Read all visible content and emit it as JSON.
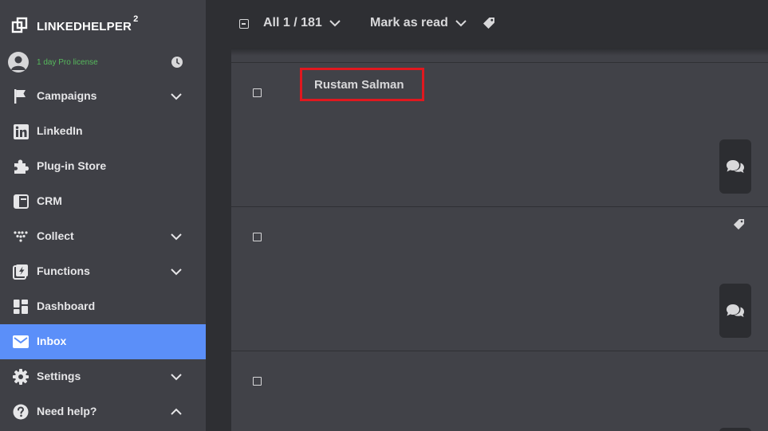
{
  "brand": {
    "name": "LINKEDHELPER",
    "superscript": "2"
  },
  "license": {
    "text": "1 day Pro license"
  },
  "nav": [
    {
      "id": "campaigns",
      "label": "Campaigns",
      "icon": "flag-icon",
      "expandable": true,
      "expanded": false
    },
    {
      "id": "linkedin",
      "label": "LinkedIn",
      "icon": "linkedin-icon",
      "expandable": false
    },
    {
      "id": "plugin-store",
      "label": "Plug-in Store",
      "icon": "puzzle-icon",
      "expandable": false
    },
    {
      "id": "crm",
      "label": "CRM",
      "icon": "crm-icon",
      "expandable": false
    },
    {
      "id": "collect",
      "label": "Collect",
      "icon": "collect-icon",
      "expandable": true,
      "expanded": false
    },
    {
      "id": "functions",
      "label": "Functions",
      "icon": "functions-icon",
      "expandable": true,
      "expanded": false
    },
    {
      "id": "dashboard",
      "label": "Dashboard",
      "icon": "dashboard-icon",
      "expandable": false
    },
    {
      "id": "inbox",
      "label": "Inbox",
      "icon": "envelope-icon",
      "expandable": false,
      "active": true
    },
    {
      "id": "settings",
      "label": "Settings",
      "icon": "gear-icon",
      "expandable": true,
      "expanded": false
    },
    {
      "id": "need-help",
      "label": "Need help?",
      "icon": "question-icon",
      "expandable": true,
      "expanded": true
    }
  ],
  "toolbar": {
    "selection_label": "All 1 / 181",
    "mark_read_label": "Mark as read"
  },
  "messages": [
    {
      "name": "Rustam Salman",
      "has_tag": false,
      "highlighted": true
    },
    {
      "name": "",
      "has_tag": true
    },
    {
      "name": "",
      "has_tag": false
    }
  ],
  "colors": {
    "accent": "#5b8ff9",
    "sidebar": "#3f4046",
    "background": "#2e2f33",
    "list": "#414248",
    "license": "#56b95c",
    "highlight": "#e0181f"
  }
}
